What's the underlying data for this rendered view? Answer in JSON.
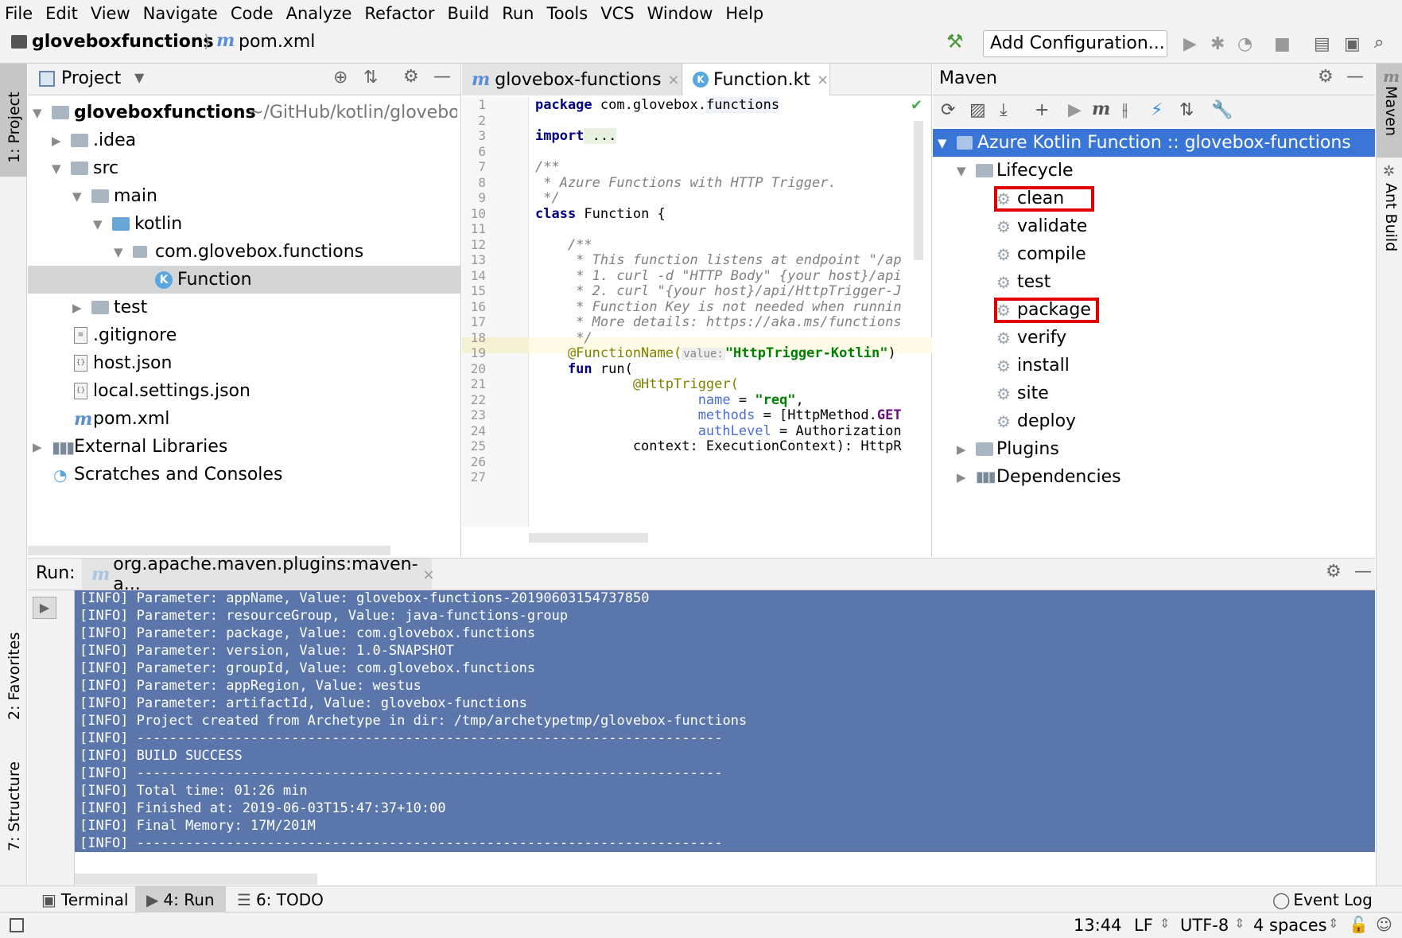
{
  "menu": [
    "File",
    "Edit",
    "View",
    "Navigate",
    "Code",
    "Analyze",
    "Refactor",
    "Build",
    "Run",
    "Tools",
    "VCS",
    "Window",
    "Help"
  ],
  "breadcrumb": {
    "project": "gloveboxfunctions",
    "file": "pom.xml"
  },
  "toolbar": {
    "add_configuration": "Add Configuration..."
  },
  "left_strip": {
    "project": "1: Project",
    "favorites": "2: Favorites",
    "structure": "7: Structure"
  },
  "right_strip": {
    "maven": "Maven",
    "ant": "Ant Build"
  },
  "project_panel": {
    "title": "Project",
    "root_name": "gloveboxfunctions",
    "root_path": "~/GitHub/kotlin/glovebox",
    "items": [
      ".idea",
      "src",
      "main",
      "kotlin",
      "com.glovebox.functions",
      "Function",
      "test",
      ".gitignore",
      "host.json",
      "local.settings.json",
      "pom.xml",
      "External Libraries",
      "Scratches and Consoles"
    ]
  },
  "editor": {
    "tabs": [
      "glovebox-functions",
      "Function.kt"
    ],
    "line_numbers": [
      "1",
      "2",
      "3",
      "6",
      "7",
      "8",
      "9",
      "10",
      "11",
      "12",
      "13",
      "14",
      "15",
      "16",
      "17",
      "18",
      "19",
      "20",
      "21",
      "22",
      "23",
      "24",
      "25",
      "26",
      "27"
    ],
    "code": {
      "l1_kw": "package",
      "l1_rest": " com.glovebox.",
      "l1_pkg": "functions",
      "l3_kw": "import",
      "l3_rest": " ...",
      "l7": "/**",
      "l8": " * Azure Functions with HTTP Trigger.",
      "l9": " */",
      "l10_kw": "class",
      "l10_rest": " Function {",
      "l12": "    /**",
      "l13": "     * This function listens at endpoint \"/ap",
      "l14": "     * 1. curl -d \"HTTP Body\" {your host}/api",
      "l15": "     * 2. curl \"{your host}/api/HttpTrigger-J",
      "l16": "     * Function Key is not needed when runnin",
      "l17": "     * More details: https://aka.ms/functions",
      "l18": "     */",
      "l19_ann": "    @FunctionName(",
      "l19_hint": "value:",
      "l19_str": "\"HttpTrigger-Kotlin\"",
      "l19_end": ")",
      "l20_kw": "    fun",
      "l20_rest": " run(",
      "l21_ann": "            @HttpTrigger(",
      "l22_param": "                    name",
      "l22_eq": " = ",
      "l22_str": "\"req\"",
      "l22_end": ",",
      "l23_param": "                    methods",
      "l23_rest": " = [HttpMethod.",
      "l23_kw": "GET",
      "l24_param": "                    authLevel",
      "l24_rest": " = Authorization",
      "l25": "            context: ExecutionContext): HttpR"
    }
  },
  "maven": {
    "title": "Maven",
    "root": "Azure Kotlin Function :: glovebox-functions",
    "lifecycle": "Lifecycle",
    "goals": [
      "clean",
      "validate",
      "compile",
      "test",
      "package",
      "verify",
      "install",
      "site",
      "deploy"
    ],
    "plugins": "Plugins",
    "dependencies": "Dependencies",
    "highlighted_goals": [
      "clean",
      "package"
    ]
  },
  "run": {
    "label": "Run:",
    "tab": "org.apache.maven.plugins:maven-a...",
    "console": [
      "[INFO] Parameter: appName, Value: glovebox-functions-20190603154737850",
      "[INFO] Parameter: resourceGroup, Value: java-functions-group",
      "[INFO] Parameter: package, Value: com.glovebox.functions",
      "[INFO] Parameter: version, Value: 1.0-SNAPSHOT",
      "[INFO] Parameter: groupId, Value: com.glovebox.functions",
      "[INFO] Parameter: appRegion, Value: westus",
      "[INFO] Parameter: artifactId, Value: glovebox-functions",
      "[INFO] Project created from Archetype in dir: /tmp/archetypetmp/glovebox-functions",
      "[INFO] ------------------------------------------------------------------------",
      "[INFO] BUILD SUCCESS",
      "[INFO] ------------------------------------------------------------------------",
      "[INFO] Total time: 01:26 min",
      "[INFO] Finished at: 2019-06-03T15:47:37+10:00",
      "[INFO] Final Memory: 17M/201M",
      "[INFO] ------------------------------------------------------------------------"
    ]
  },
  "bottom_tabs": {
    "terminal": "Terminal",
    "run": "4: Run",
    "todo": "6: TODO",
    "event_log": "Event Log"
  },
  "status": {
    "position": "13:44",
    "line_sep": "LF",
    "encoding": "UTF-8",
    "indent": "4 spaces"
  },
  "colors": {
    "selection": "#3875d7",
    "console_selection": "#5b76ab",
    "highlight_box": "#e00000"
  }
}
